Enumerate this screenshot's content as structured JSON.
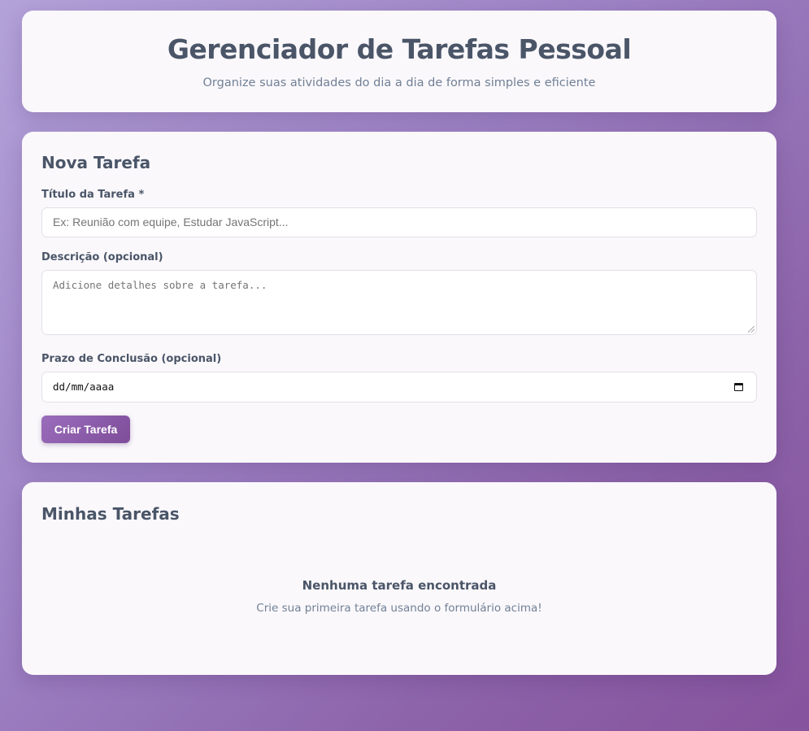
{
  "header": {
    "title": "Gerenciador de Tarefas Pessoal",
    "subtitle": "Organize suas atividades do dia a dia de forma simples e eficiente"
  },
  "form": {
    "section_title": "Nova Tarefa",
    "title_label": "Título da Tarefa *",
    "title_placeholder": "Ex: Reunião com equipe, Estudar JavaScript...",
    "description_label": "Descrição (opcional)",
    "description_placeholder": "Adicione detalhes sobre a tarefa...",
    "deadline_label": "Prazo de Conclusão (opcional)",
    "deadline_placeholder": "dd/mm/aaaa",
    "submit_label": "Criar Tarefa"
  },
  "tasks": {
    "section_title": "Minhas Tarefas",
    "empty_title": "Nenhuma tarefa encontrada",
    "empty_subtitle": "Crie sua primeira tarefa usando o formulário acima!"
  },
  "icons": {
    "date_picker": "calendar-icon",
    "textarea_resize": "resize-grip-icon"
  },
  "colors": {
    "accent": "#8c5aa8",
    "text": "#4a5568",
    "muted": "#718096"
  }
}
